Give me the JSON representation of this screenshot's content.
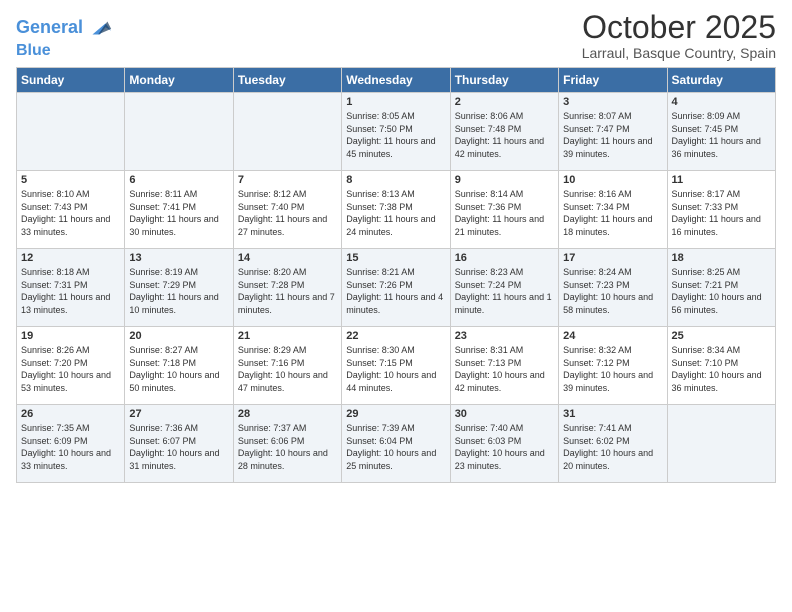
{
  "header": {
    "logo_line1": "General",
    "logo_line2": "Blue",
    "month_title": "October 2025",
    "location": "Larraul, Basque Country, Spain"
  },
  "weekdays": [
    "Sunday",
    "Monday",
    "Tuesday",
    "Wednesday",
    "Thursday",
    "Friday",
    "Saturday"
  ],
  "weeks": [
    [
      {
        "day": "",
        "sunrise": "",
        "sunset": "",
        "daylight": ""
      },
      {
        "day": "",
        "sunrise": "",
        "sunset": "",
        "daylight": ""
      },
      {
        "day": "",
        "sunrise": "",
        "sunset": "",
        "daylight": ""
      },
      {
        "day": "1",
        "sunrise": "Sunrise: 8:05 AM",
        "sunset": "Sunset: 7:50 PM",
        "daylight": "Daylight: 11 hours and 45 minutes."
      },
      {
        "day": "2",
        "sunrise": "Sunrise: 8:06 AM",
        "sunset": "Sunset: 7:48 PM",
        "daylight": "Daylight: 11 hours and 42 minutes."
      },
      {
        "day": "3",
        "sunrise": "Sunrise: 8:07 AM",
        "sunset": "Sunset: 7:47 PM",
        "daylight": "Daylight: 11 hours and 39 minutes."
      },
      {
        "day": "4",
        "sunrise": "Sunrise: 8:09 AM",
        "sunset": "Sunset: 7:45 PM",
        "daylight": "Daylight: 11 hours and 36 minutes."
      }
    ],
    [
      {
        "day": "5",
        "sunrise": "Sunrise: 8:10 AM",
        "sunset": "Sunset: 7:43 PM",
        "daylight": "Daylight: 11 hours and 33 minutes."
      },
      {
        "day": "6",
        "sunrise": "Sunrise: 8:11 AM",
        "sunset": "Sunset: 7:41 PM",
        "daylight": "Daylight: 11 hours and 30 minutes."
      },
      {
        "day": "7",
        "sunrise": "Sunrise: 8:12 AM",
        "sunset": "Sunset: 7:40 PM",
        "daylight": "Daylight: 11 hours and 27 minutes."
      },
      {
        "day": "8",
        "sunrise": "Sunrise: 8:13 AM",
        "sunset": "Sunset: 7:38 PM",
        "daylight": "Daylight: 11 hours and 24 minutes."
      },
      {
        "day": "9",
        "sunrise": "Sunrise: 8:14 AM",
        "sunset": "Sunset: 7:36 PM",
        "daylight": "Daylight: 11 hours and 21 minutes."
      },
      {
        "day": "10",
        "sunrise": "Sunrise: 8:16 AM",
        "sunset": "Sunset: 7:34 PM",
        "daylight": "Daylight: 11 hours and 18 minutes."
      },
      {
        "day": "11",
        "sunrise": "Sunrise: 8:17 AM",
        "sunset": "Sunset: 7:33 PM",
        "daylight": "Daylight: 11 hours and 16 minutes."
      }
    ],
    [
      {
        "day": "12",
        "sunrise": "Sunrise: 8:18 AM",
        "sunset": "Sunset: 7:31 PM",
        "daylight": "Daylight: 11 hours and 13 minutes."
      },
      {
        "day": "13",
        "sunrise": "Sunrise: 8:19 AM",
        "sunset": "Sunset: 7:29 PM",
        "daylight": "Daylight: 11 hours and 10 minutes."
      },
      {
        "day": "14",
        "sunrise": "Sunrise: 8:20 AM",
        "sunset": "Sunset: 7:28 PM",
        "daylight": "Daylight: 11 hours and 7 minutes."
      },
      {
        "day": "15",
        "sunrise": "Sunrise: 8:21 AM",
        "sunset": "Sunset: 7:26 PM",
        "daylight": "Daylight: 11 hours and 4 minutes."
      },
      {
        "day": "16",
        "sunrise": "Sunrise: 8:23 AM",
        "sunset": "Sunset: 7:24 PM",
        "daylight": "Daylight: 11 hours and 1 minute."
      },
      {
        "day": "17",
        "sunrise": "Sunrise: 8:24 AM",
        "sunset": "Sunset: 7:23 PM",
        "daylight": "Daylight: 10 hours and 58 minutes."
      },
      {
        "day": "18",
        "sunrise": "Sunrise: 8:25 AM",
        "sunset": "Sunset: 7:21 PM",
        "daylight": "Daylight: 10 hours and 56 minutes."
      }
    ],
    [
      {
        "day": "19",
        "sunrise": "Sunrise: 8:26 AM",
        "sunset": "Sunset: 7:20 PM",
        "daylight": "Daylight: 10 hours and 53 minutes."
      },
      {
        "day": "20",
        "sunrise": "Sunrise: 8:27 AM",
        "sunset": "Sunset: 7:18 PM",
        "daylight": "Daylight: 10 hours and 50 minutes."
      },
      {
        "day": "21",
        "sunrise": "Sunrise: 8:29 AM",
        "sunset": "Sunset: 7:16 PM",
        "daylight": "Daylight: 10 hours and 47 minutes."
      },
      {
        "day": "22",
        "sunrise": "Sunrise: 8:30 AM",
        "sunset": "Sunset: 7:15 PM",
        "daylight": "Daylight: 10 hours and 44 minutes."
      },
      {
        "day": "23",
        "sunrise": "Sunrise: 8:31 AM",
        "sunset": "Sunset: 7:13 PM",
        "daylight": "Daylight: 10 hours and 42 minutes."
      },
      {
        "day": "24",
        "sunrise": "Sunrise: 8:32 AM",
        "sunset": "Sunset: 7:12 PM",
        "daylight": "Daylight: 10 hours and 39 minutes."
      },
      {
        "day": "25",
        "sunrise": "Sunrise: 8:34 AM",
        "sunset": "Sunset: 7:10 PM",
        "daylight": "Daylight: 10 hours and 36 minutes."
      }
    ],
    [
      {
        "day": "26",
        "sunrise": "Sunrise: 7:35 AM",
        "sunset": "Sunset: 6:09 PM",
        "daylight": "Daylight: 10 hours and 33 minutes."
      },
      {
        "day": "27",
        "sunrise": "Sunrise: 7:36 AM",
        "sunset": "Sunset: 6:07 PM",
        "daylight": "Daylight: 10 hours and 31 minutes."
      },
      {
        "day": "28",
        "sunrise": "Sunrise: 7:37 AM",
        "sunset": "Sunset: 6:06 PM",
        "daylight": "Daylight: 10 hours and 28 minutes."
      },
      {
        "day": "29",
        "sunrise": "Sunrise: 7:39 AM",
        "sunset": "Sunset: 6:04 PM",
        "daylight": "Daylight: 10 hours and 25 minutes."
      },
      {
        "day": "30",
        "sunrise": "Sunrise: 7:40 AM",
        "sunset": "Sunset: 6:03 PM",
        "daylight": "Daylight: 10 hours and 23 minutes."
      },
      {
        "day": "31",
        "sunrise": "Sunrise: 7:41 AM",
        "sunset": "Sunset: 6:02 PM",
        "daylight": "Daylight: 10 hours and 20 minutes."
      },
      {
        "day": "",
        "sunrise": "",
        "sunset": "",
        "daylight": ""
      }
    ]
  ]
}
